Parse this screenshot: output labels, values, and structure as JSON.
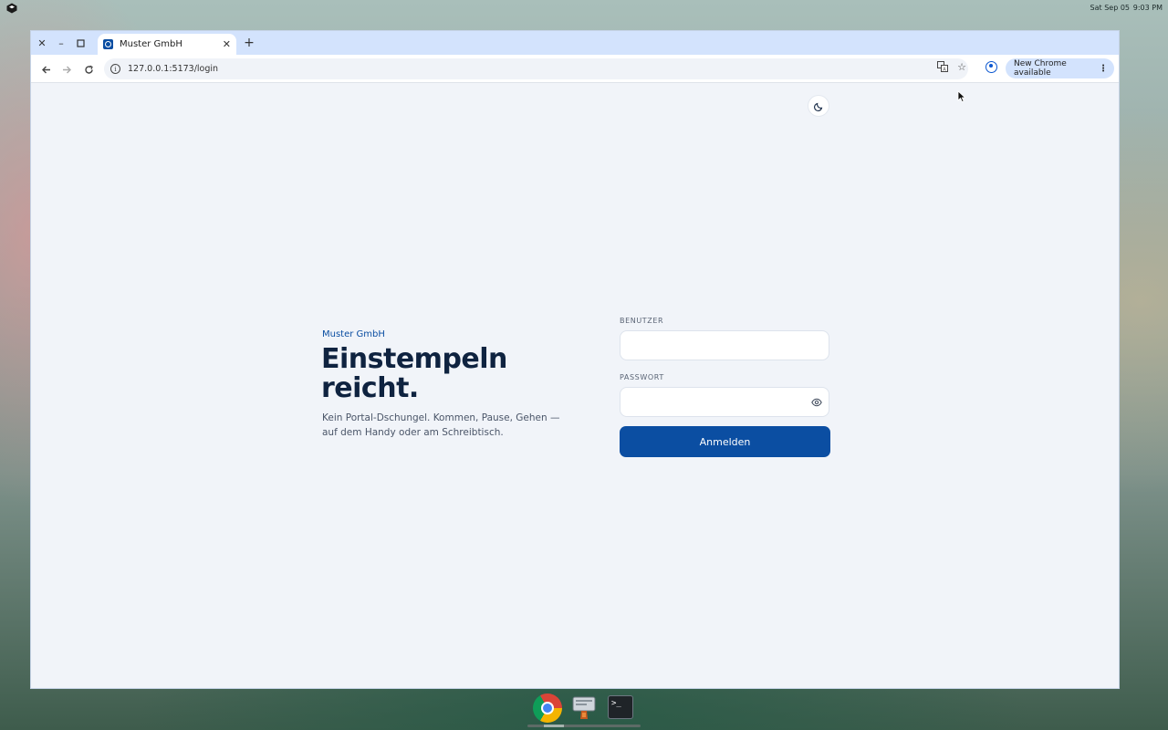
{
  "os": {
    "date": "Sat Sep 05",
    "time": "9:03 PM"
  },
  "browser": {
    "tab": {
      "title": "Muster GmbH"
    },
    "url": "127.0.0.1:5173/login",
    "update_label": "New Chrome available"
  },
  "page": {
    "brand": "Muster GmbH",
    "headline": "Einstempeln reicht.",
    "subtext": "Kein Portal-Dschungel. Kommen, Pause, Gehen — auf dem Handy oder am Schreibtisch.",
    "form": {
      "user_label": "BENUTZER",
      "user_value": "",
      "password_label": "PASSWORT",
      "password_value": "",
      "submit_label": "Anmelden"
    }
  },
  "icons": {
    "theme_toggle": "moon-icon",
    "password_visibility": "eye-icon"
  },
  "colors": {
    "primary": "#0b4ea2",
    "headline": "#0f2340",
    "page_bg": "#f1f4f9",
    "tabstrip_bg": "#d3e3fd"
  }
}
